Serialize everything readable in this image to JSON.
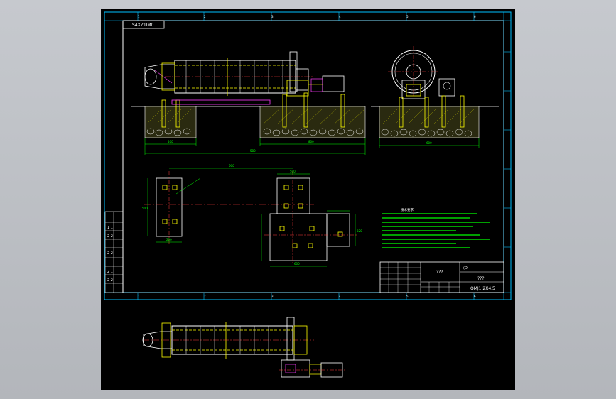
{
  "drawing": {
    "corner_tag": "S4XZ1IM0",
    "title_block": {
      "name_primary": "???",
      "name_secondary": "???",
      "drawing_number": "QMJ1.2X4.5",
      "corner_mark": "(D"
    },
    "revision_rows": [
      "1  1",
      "2  2",
      "2  2",
      "2  1",
      "2  2"
    ],
    "border_zones": {
      "top": [
        "1",
        "2",
        "3",
        "4",
        "5",
        "6"
      ],
      "bottom": [
        "1",
        "2",
        "3",
        "4",
        "5",
        "6"
      ]
    },
    "tech_notes_heading": "技术要求",
    "dimension_labels": {
      "front_total": "580",
      "front_left": "400",
      "front_right": "800",
      "side_total": "600",
      "side_left": "400",
      "plan_top": "600",
      "plan_mid": "500",
      "plan_bottom": "600",
      "plan_right": "320",
      "plan_left_h": "500",
      "plan_small": "200"
    }
  }
}
